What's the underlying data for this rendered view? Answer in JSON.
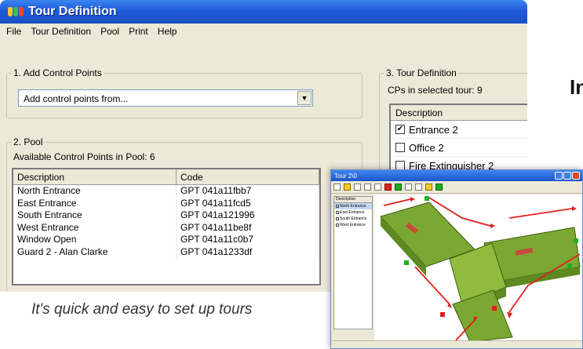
{
  "window": {
    "title": "Tour Definition"
  },
  "menu": [
    "File",
    "Tour Definition",
    "Pool",
    "Print",
    "Help"
  ],
  "add_points": {
    "title": "1. Add Control Points",
    "dropdown_value": "Add control points from..."
  },
  "pool": {
    "title": "2. Pool",
    "count_text": "Available Control Points in Pool: 6",
    "columns": [
      "Description",
      "Code"
    ],
    "rows": [
      [
        "North Entrance",
        "GPT 041a11fbb7"
      ],
      [
        "East Entrance",
        "GPT 041a11fcd5"
      ],
      [
        "South Entrance",
        "GPT 041a121996"
      ],
      [
        "West Entrance",
        "GPT 041a11be8f"
      ],
      [
        "Window Open",
        "GPT 041a11c0b7"
      ],
      [
        "Guard 2 - Alan Clarke",
        "GPT 041a1233df"
      ]
    ]
  },
  "tour_definition": {
    "title": "3. Tour Definition",
    "count_text": "CPs in selected tour: 9",
    "column": "Description",
    "rows": [
      {
        "label": "Entrance 2",
        "checked": true
      },
      {
        "label": "Office 2",
        "checked": false
      },
      {
        "label": "Fire Extinguisher 2",
        "checked": false
      }
    ]
  },
  "heading_fragment": "In",
  "caption": "It's quick and easy to set up tours",
  "overlay": {
    "title": "Tour 2\\0",
    "side_header": "Description",
    "side_items": [
      "North Entrance",
      "East Entrance",
      "South Entrance",
      "West Entrance"
    ],
    "colors": {
      "floor": "#7aa832",
      "wall": "#5e8a22",
      "corridor": "#c94a3a",
      "route": "#e02020",
      "marker": "#20b020"
    }
  }
}
